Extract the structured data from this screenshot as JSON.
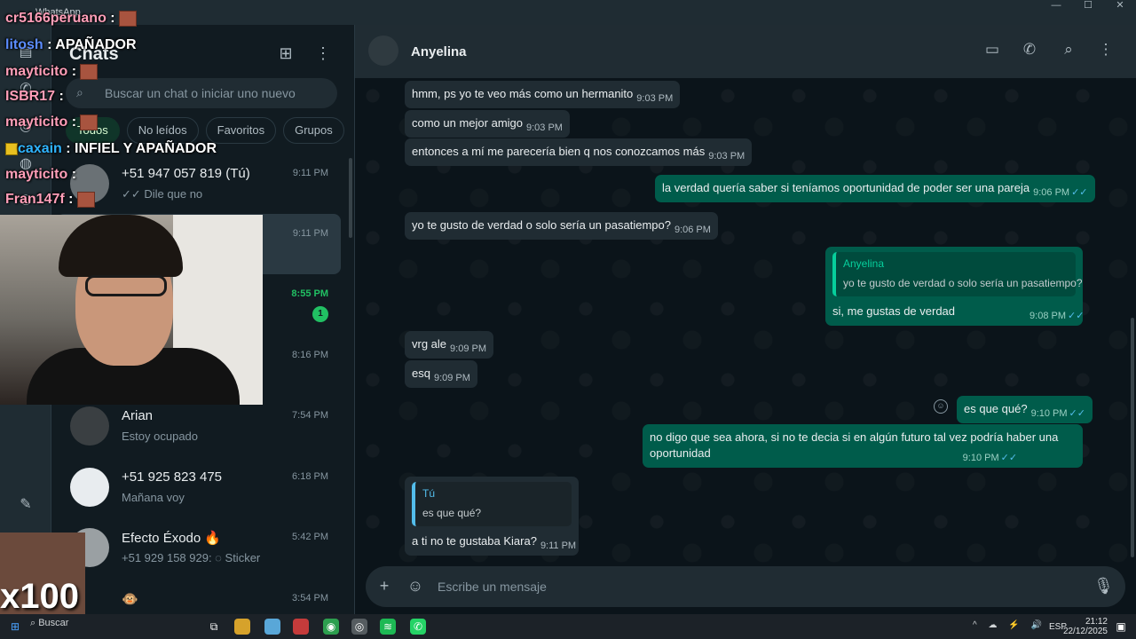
{
  "window": {
    "title": "WhatsApp",
    "controls": [
      "—",
      "☐",
      "✕"
    ]
  },
  "sidebar": {
    "title": "Chats",
    "search_placeholder": "Buscar un chat o iniciar uno nuevo",
    "filters": [
      "Todos",
      "No leídos",
      "Favoritos",
      "Grupos"
    ],
    "chats": [
      {
        "name": "+51 947 057 819 (Tú)",
        "preview": "✓✓ Dile que no",
        "time": "9:11 PM"
      },
      {
        "name": "",
        "preview": "",
        "time": "9:11 PM"
      },
      {
        "name": "",
        "preview": "",
        "time": "8:55 PM",
        "unread": "1"
      },
      {
        "name": "",
        "preview": "",
        "time": "8:16 PM"
      },
      {
        "name": "Arian",
        "preview": "Estoy ocupado",
        "time": "7:54 PM"
      },
      {
        "name": "+51 925 823 475",
        "preview": "Mañana voy",
        "time": "6:18 PM"
      },
      {
        "name": "Efecto Éxodo 🔥",
        "preview": "+51 929 158 929: ◌ Sticker",
        "time": "5:42 PM"
      },
      {
        "name": "🐵",
        "preview": "",
        "time": "3:54 PM"
      }
    ]
  },
  "chat": {
    "contact": "Anyelina",
    "composer_placeholder": "Escribe un mensaje",
    "messages": [
      {
        "dir": "in",
        "text": "hmm, ps yo te veo más como un hermanito",
        "time": "9:03 PM"
      },
      {
        "dir": "in",
        "text": "como un mejor amigo",
        "time": "9:03 PM"
      },
      {
        "dir": "in",
        "text": "entonces a mí me parecería bien q nos conozcamos más",
        "time": "9:03 PM"
      },
      {
        "dir": "out",
        "text": "la verdad quería saber si teníamos oportunidad de poder ser una pareja",
        "time": "9:06 PM"
      },
      {
        "dir": "in",
        "text": "yo te gusto de verdad o solo sería un pasatiempo?",
        "time": "9:06 PM"
      },
      {
        "dir": "out",
        "quote_name": "Anyelina",
        "quote_text": "yo te gusto de verdad o solo sería un pasatiempo?",
        "text": "si, me gustas de verdad",
        "time": "9:08 PM"
      },
      {
        "dir": "in",
        "text": "vrg ale",
        "time": "9:09 PM"
      },
      {
        "dir": "in",
        "text": "esq",
        "time": "9:09 PM"
      },
      {
        "dir": "out",
        "text": "es que qué?",
        "time": "9:10 PM"
      },
      {
        "dir": "out",
        "text_line1": "no digo que sea ahora, si no te decia si en algún futuro tal vez podría haber una",
        "text_line2": "oportunidad",
        "time": "9:10 PM"
      },
      {
        "dir": "in",
        "quote_name": "Tú",
        "quote_text": "es que qué?",
        "text": "a ti no te gustaba Kiara?",
        "time": "9:11 PM"
      }
    ]
  },
  "stream_overlay": {
    "lines": [
      {
        "user": "cr5166peruano",
        "msg": " : "
      },
      {
        "user": "litosh",
        "msg": " : APAÑADOR"
      },
      {
        "user": "mayticito",
        "msg": " : "
      },
      {
        "user": "ISBR17",
        "msg": " : "
      },
      {
        "user": "mayticito",
        "msg": " : "
      },
      {
        "user": "caxain",
        "msg": " : INFIEL Y APAÑADOR"
      },
      {
        "user": "mayticito",
        "msg": " : "
      },
      {
        "user": "Fran147f",
        "msg": " : "
      }
    ],
    "emote_multiplier": "x100"
  },
  "taskbar": {
    "search_label": "Buscar",
    "lang": "ESP",
    "clock_time": "21:12",
    "clock_date": "22/12/2025"
  }
}
